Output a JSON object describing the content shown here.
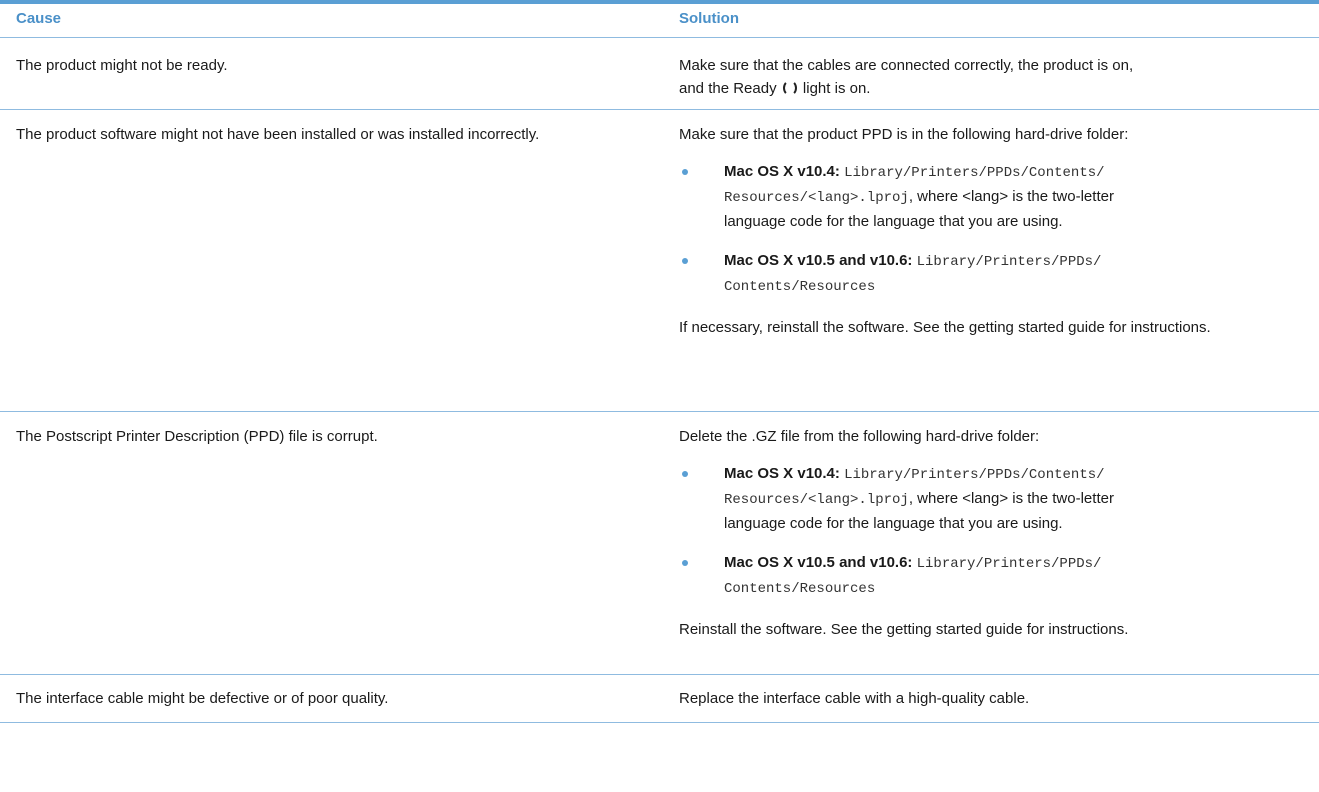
{
  "header": {
    "cause": "Cause",
    "solution": "Solution"
  },
  "rows": [
    {
      "cause": "The product might not be ready.",
      "solution": {
        "line1": "Make sure that the cables are connected correctly, the product is on,",
        "line2a": "and the Ready",
        "ready_icon": "ready-light-icon",
        "line2b": "light is on."
      }
    },
    {
      "cause": "The product software might not have been installed or was installed incorrectly.",
      "solution": {
        "intro": "Make sure that the product PPD is in the following hard-drive folder:",
        "bullets": [
          {
            "label": "Mac OS X v10.4:",
            "path1": "Library/Printers/PPDs/Contents/",
            "path2": "Resources/<lang>.lproj",
            "text": ", where <lang> is the two-letter",
            "text2": "language code for the language that you are using."
          },
          {
            "label": "Mac OS X v10.5 and v10.6:",
            "path1": "Library/Printers/PPDs/",
            "path2": "Contents/Resources"
          }
        ],
        "outro": "If necessary, reinstall the software. See the getting started guide for instructions."
      }
    },
    {
      "cause": "The Postscript Printer Description (PPD) file is corrupt.",
      "solution": {
        "intro": "Delete the .GZ file from the following hard-drive folder:",
        "bullets": [
          {
            "label": "Mac OS X v10.4:",
            "path1": "Library/Printers/PPDs/Contents/",
            "path2": "Resources/<lang>.lproj",
            "text": ", where <lang> is the two-letter",
            "text2": "language code for the language that you are using."
          },
          {
            "label": "Mac OS X v10.5 and v10.6:",
            "path1": "Library/Printers/PPDs/",
            "path2": "Contents/Resources"
          }
        ],
        "outro": "Reinstall the software. See the getting started guide for instructions."
      }
    },
    {
      "cause": "The interface cable might be defective or of poor quality.",
      "solution": {
        "text": "Replace the interface cable with a high-quality cable."
      }
    }
  ],
  "colors": {
    "accent": "#5a9fd4",
    "header_text": "#4a90c8",
    "rule": "#8fbbe0"
  }
}
